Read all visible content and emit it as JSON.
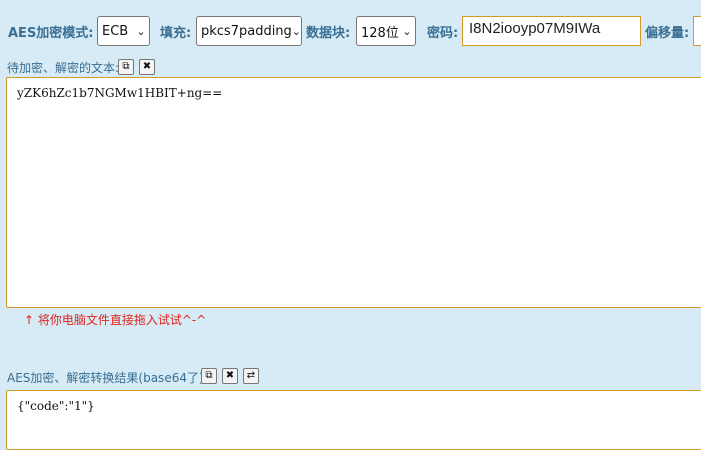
{
  "toolbar": {
    "mode_label": "AES加密模式:",
    "mode_value": "ECB",
    "padding_label": "填充:",
    "padding_value": "pkcs7padding",
    "block_label": "数据块:",
    "block_value": "128位",
    "key_label": "密码:",
    "key_value": "I8N2iooyp07M9IWa",
    "offset_label": "偏移量:"
  },
  "input_section": {
    "label": "待加密、解密的文本:",
    "text": "yZK6hZc1b7NGMw1HBIT+ng==",
    "hint": "↑ 将你电脑文件直接拖入试试^-^"
  },
  "output_section": {
    "label": "AES加密、解密转换结果(base64了):",
    "text": "{\"code\":\"1\"}"
  },
  "icons": {
    "copy": "⧉",
    "clear": "✖",
    "swap": "⇄"
  }
}
